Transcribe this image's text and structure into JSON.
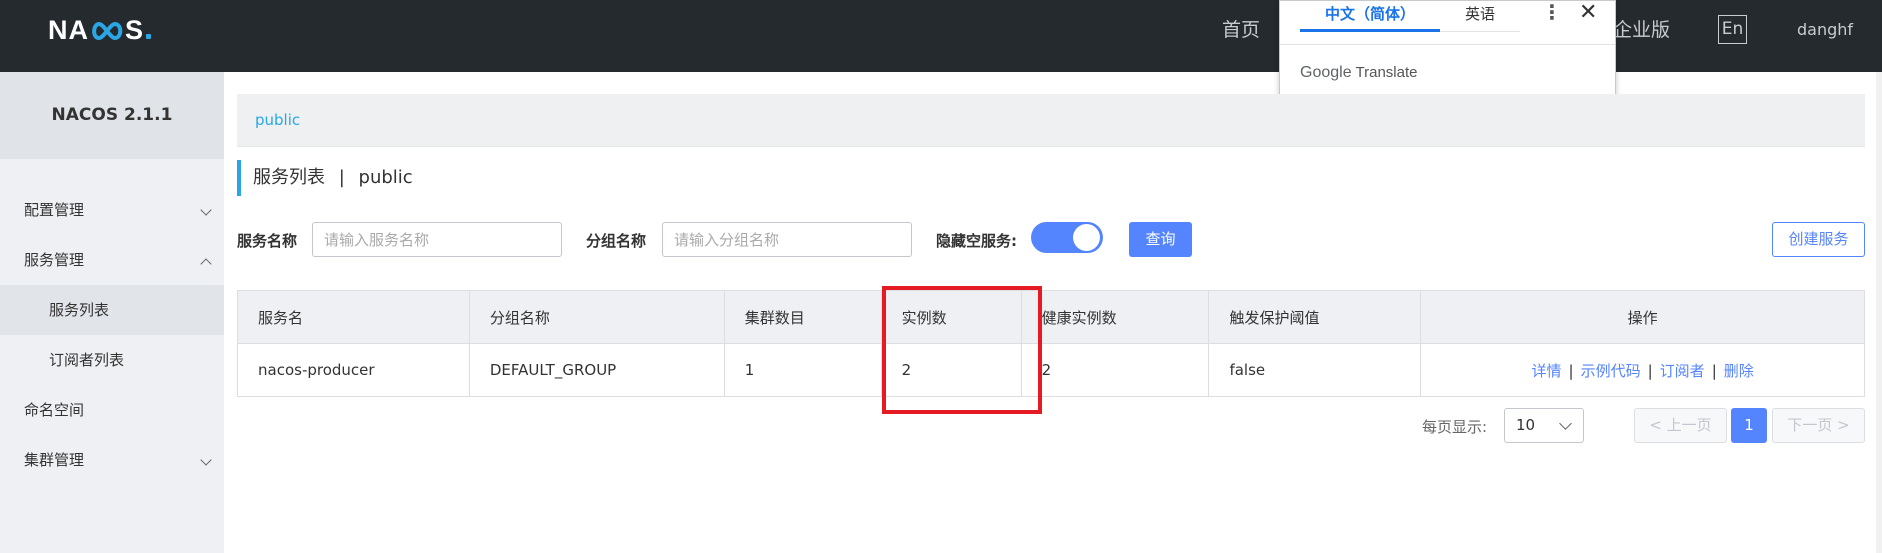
{
  "topbar": {
    "logo": {
      "prefix": "NA",
      "suffix": "S"
    },
    "nav_home": "首页",
    "nav_enterprise": "企业版",
    "lang": "En",
    "user": "danghf"
  },
  "translate_popup": {
    "tab_zh": "中文（简体）",
    "tab_en": "英语",
    "brand_google": "Google",
    "brand_translate": "Translate"
  },
  "sidebar": {
    "title": "NACOS 2.1.1",
    "items": [
      {
        "label": "配置管理"
      },
      {
        "label": "服务管理"
      },
      {
        "label": "服务列表"
      },
      {
        "label": "订阅者列表"
      },
      {
        "label": "命名空间"
      },
      {
        "label": "集群管理"
      }
    ]
  },
  "breadcrumb": {
    "namespace": "public"
  },
  "page_title": {
    "text": "服务列表",
    "separator": "|",
    "namespace": "public"
  },
  "filters": {
    "service_name_label": "服务名称",
    "service_name_placeholder": "请输入服务名称",
    "group_name_label": "分组名称",
    "group_name_placeholder": "请输入分组名称",
    "hide_empty_label": "隐藏空服务:",
    "hide_empty_on": true,
    "query_label": "查询",
    "create_label": "创建服务"
  },
  "table": {
    "headers": [
      "服务名",
      "分组名称",
      "集群数目",
      "实例数",
      "健康实例数",
      "触发保护阈值",
      "操作"
    ],
    "rows": [
      {
        "service": "nacos-producer",
        "group": "DEFAULT_GROUP",
        "clusters": "1",
        "instances": "2",
        "healthy": "2",
        "threshold": "false",
        "ops": [
          "详情",
          "示例代码",
          "订阅者",
          "删除"
        ]
      }
    ]
  },
  "pagination": {
    "page_size_label": "每页显示:",
    "page_size": "10",
    "prev_label": "上一页",
    "current_page": "1",
    "next_label": "下一页"
  },
  "colors": {
    "topbar_bg": "#252a2f",
    "accent": "#2aa6e5",
    "primary": "#5584ff",
    "highlight_border": "#e51b24"
  }
}
